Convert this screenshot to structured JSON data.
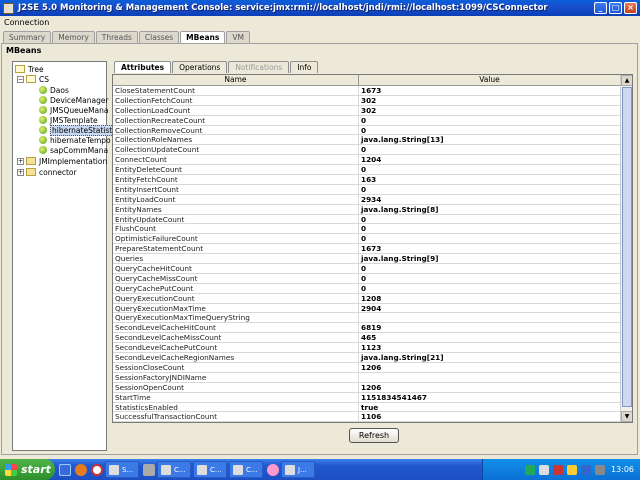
{
  "window": {
    "title": "J2SE 5.0 Monitoring & Management Console: service:jmx:rmi://localhost/jndi/rmi://localhost:1099/CSConnector"
  },
  "menubar": {
    "connection": "Connection"
  },
  "top_tabs": [
    "Summary",
    "Memory",
    "Threads",
    "Classes",
    "MBeans",
    "VM"
  ],
  "active_top_tab": "MBeans",
  "mbeans_label": "MBeans",
  "tree": {
    "root": "Tree",
    "cs": "CS",
    "items": [
      "Daos",
      "DeviceManager",
      "JMSQueueMana",
      "JMSTemplate",
      "hibernateStatist",
      "hibernateTempo",
      "sapCommMana"
    ],
    "selected": "hibernateStatist",
    "other": [
      "JMImplementation",
      "connector"
    ]
  },
  "sub_tabs": [
    "Attributes",
    "Operations",
    "Notifications",
    "Info"
  ],
  "table": {
    "headers": [
      "Name",
      "Value"
    ],
    "rows": [
      [
        "CloseStatementCount",
        "1673"
      ],
      [
        "CollectionFetchCount",
        "302"
      ],
      [
        "CollectionLoadCount",
        "302"
      ],
      [
        "CollectionRecreateCount",
        "0"
      ],
      [
        "CollectionRemoveCount",
        "0"
      ],
      [
        "CollectionRoleNames",
        "java.lang.String[13]"
      ],
      [
        "CollectionUpdateCount",
        "0"
      ],
      [
        "ConnectCount",
        "1204"
      ],
      [
        "EntityDeleteCount",
        "0"
      ],
      [
        "EntityFetchCount",
        "163"
      ],
      [
        "EntityInsertCount",
        "0"
      ],
      [
        "EntityLoadCount",
        "2934"
      ],
      [
        "EntityNames",
        "java.lang.String[8]"
      ],
      [
        "EntityUpdateCount",
        "0"
      ],
      [
        "FlushCount",
        "0"
      ],
      [
        "OptimisticFailureCount",
        "0"
      ],
      [
        "PrepareStatementCount",
        "1673"
      ],
      [
        "Queries",
        "java.lang.String[9]"
      ],
      [
        "QueryCacheHitCount",
        "0"
      ],
      [
        "QueryCacheMissCount",
        "0"
      ],
      [
        "QueryCachePutCount",
        "0"
      ],
      [
        "QueryExecutionCount",
        "1208"
      ],
      [
        "QueryExecutionMaxTime",
        "2904"
      ],
      [
        "QueryExecutionMaxTimeQueryString",
        ""
      ],
      [
        "SecondLevelCacheHitCount",
        "6819"
      ],
      [
        "SecondLevelCacheMissCount",
        "465"
      ],
      [
        "SecondLevelCachePutCount",
        "1123"
      ],
      [
        "SecondLevelCacheRegionNames",
        "java.lang.String[21]"
      ],
      [
        "SessionCloseCount",
        "1206"
      ],
      [
        "SessionFactoryJNDIName",
        ""
      ],
      [
        "SessionOpenCount",
        "1206"
      ],
      [
        "StartTime",
        "1151834541467"
      ],
      [
        "StatisticsEnabled",
        "true"
      ],
      [
        "SuccessfulTransactionCount",
        "1106"
      ]
    ]
  },
  "refresh_label": "Refresh",
  "taskbar": {
    "start": "start",
    "tasks": [
      "S...",
      "C...",
      "C...",
      "C...",
      "J..."
    ],
    "clock": "13:06"
  }
}
